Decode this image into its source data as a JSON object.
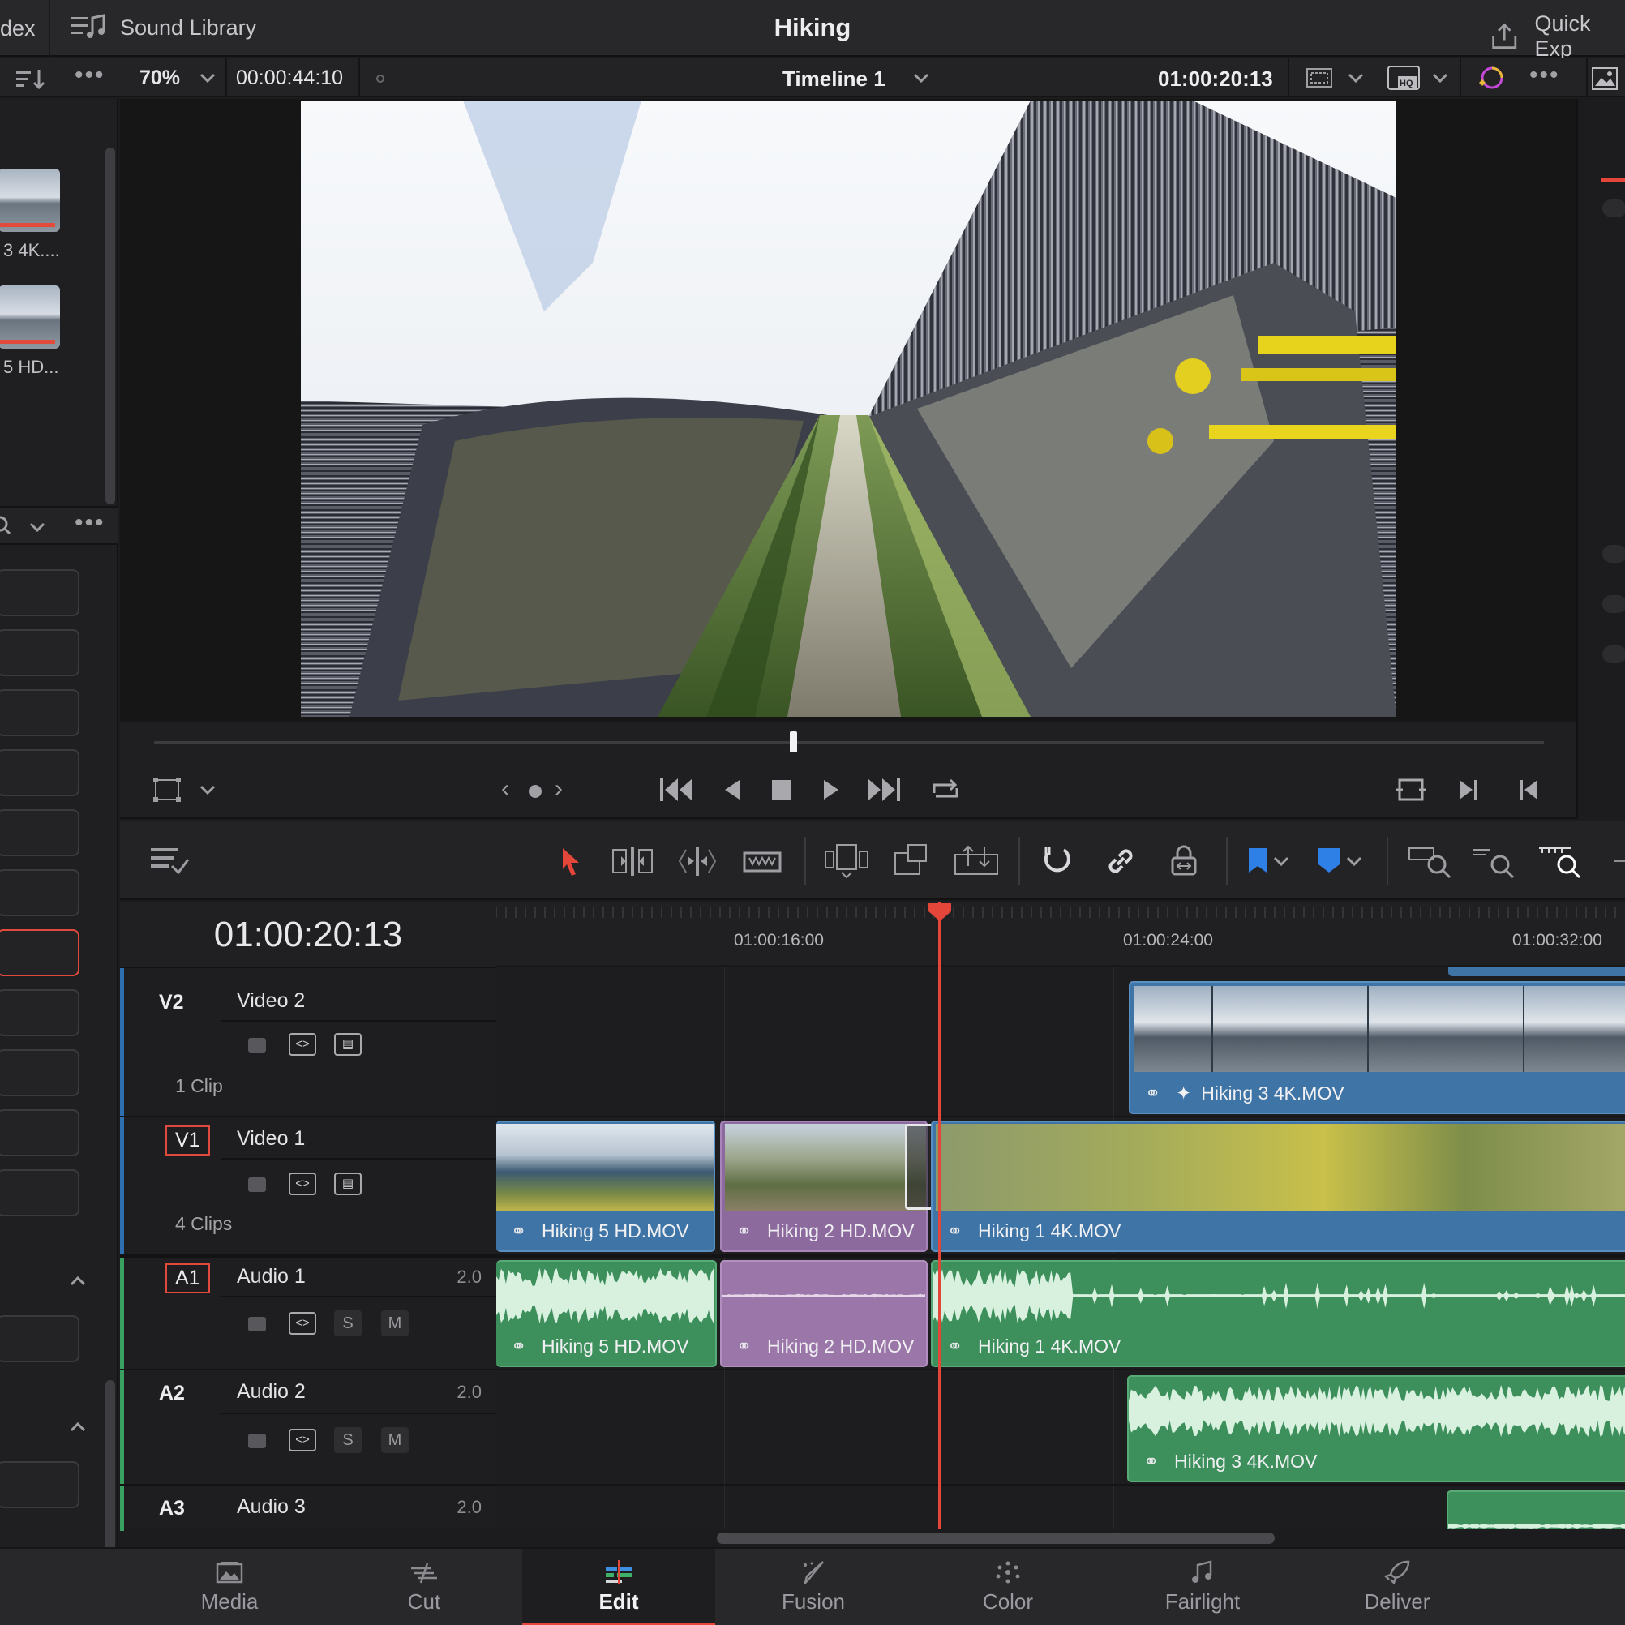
{
  "topbar": {
    "index_label": "dex",
    "sound_library_label": "Sound Library",
    "project_title": "Hiking",
    "quick_export_label": "Quick Exp"
  },
  "viewer": {
    "zoom": "70%",
    "duration_timecode": "00:00:44:10",
    "timeline_name": "Timeline 1",
    "current_timecode": "01:00:20:13",
    "scrubber_position": 0.46
  },
  "media_pool": {
    "items": [
      {
        "label": "3 4K...."
      },
      {
        "label": "5 HD..."
      }
    ]
  },
  "timeline": {
    "timecode": "01:00:20:13",
    "ruler_labels": [
      "01:00:16:00",
      "01:00:24:00",
      "01:00:32:00"
    ],
    "tracks": [
      {
        "id": "V2",
        "name": "Video 2",
        "count": "1 Clip",
        "channels": ""
      },
      {
        "id": "V1",
        "name": "Video 1",
        "count": "4 Clips",
        "channels": ""
      },
      {
        "id": "A1",
        "name": "Audio 1",
        "channels": "2.0",
        "solo": "S",
        "mute": "M"
      },
      {
        "id": "A2",
        "name": "Audio 2",
        "channels": "2.0",
        "solo": "S",
        "mute": "M"
      },
      {
        "id": "A3",
        "name": "Audio 3",
        "channels": "2.0"
      }
    ],
    "clips": {
      "v2_clip": "Hiking 3 4K.MOV",
      "v1_clip1": "Hiking 5 HD.MOV",
      "v1_clip2": "Hiking 2 HD.MOV",
      "v1_clip3": "Hiking 1 4K.MOV",
      "a1_clip1": "Hiking 5 HD.MOV",
      "a1_clip2": "Hiking 2 HD.MOV",
      "a1_clip3": "Hiking 1 4K.MOV",
      "a2_clip1": "Hiking 3 4K.MOV"
    }
  },
  "pages": [
    {
      "label": "Media",
      "icon": "media-icon"
    },
    {
      "label": "Cut",
      "icon": "cut-icon"
    },
    {
      "label": "Edit",
      "icon": "edit-icon",
      "active": true
    },
    {
      "label": "Fusion",
      "icon": "fusion-icon"
    },
    {
      "label": "Color",
      "icon": "color-icon"
    },
    {
      "label": "Fairlight",
      "icon": "fairlight-icon"
    },
    {
      "label": "Deliver",
      "icon": "deliver-icon"
    }
  ],
  "colors": {
    "accent_red": "#e4463a",
    "video_clip": "#3f74a6",
    "audio_clip": "#3d8f5c",
    "selected_clip": "#8c6a9e"
  }
}
